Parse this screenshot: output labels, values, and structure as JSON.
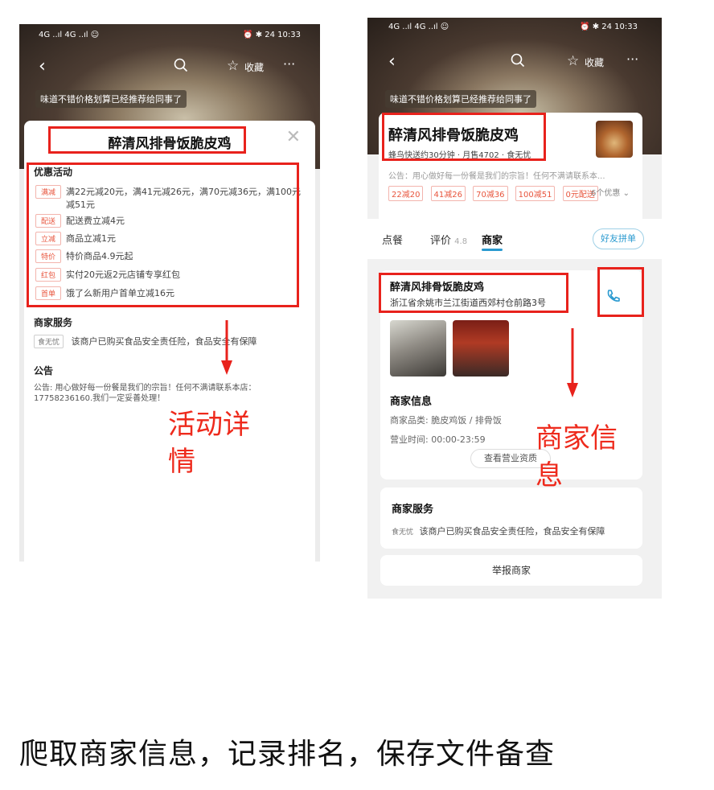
{
  "left_phone": {
    "status_left": "4G ..ıl 4G ..ıl ☺",
    "status_right": "⏰ ✱ 24 10:33",
    "banner": "味道不错价格划算已经推荐给同事了",
    "shop_name": "醉清风排骨饭脆皮鸡",
    "promotions_heading": "优惠活动",
    "promotions": [
      {
        "tag": "满减",
        "text": "满22元减20元，满41元减26元，满70元减36元，满100元减51元"
      },
      {
        "tag": "配送",
        "text": "配送费立减4元"
      },
      {
        "tag": "立减",
        "text": "商品立减1元"
      },
      {
        "tag": "特价",
        "text": "特价商品4.9元起"
      },
      {
        "tag": "红包",
        "text": "实付20元返2元店铺专享红包"
      },
      {
        "tag": "首单",
        "text": "饿了么新用户首单立减16元"
      }
    ],
    "service_heading": "商家服务",
    "service_tag": "食无忧",
    "service_text": "该商户已购买食品安全责任险，食品安全有保障",
    "notice_heading": "公告",
    "notice_text": "公告: 用心做好每一份餐是我们的宗旨！任何不满请联系本店：17758236160.我们一定妥善处理！",
    "fav_label": "收藏"
  },
  "annotation_left": "活动详情",
  "annotation_right": "商家信息",
  "right_phone": {
    "status_left": "4G ..ıl 4G ..ıl ☺",
    "status_right": "⏰ ✱ 24 10:33",
    "banner": "味道不错价格划算已经推荐给同事了",
    "fav_label": "收藏",
    "shop_name": "醉清风排骨饭脆皮鸡",
    "delivery_info": "蜂鸟快送约30分钟 · 月售4702 · 食无忧",
    "notice_short": "公告：用心做好每一份餐是我们的宗旨！任何不满请联系本...",
    "coupons": [
      "22减20",
      "41减26",
      "70减36",
      "100减51",
      "0元配送"
    ],
    "more_offers": "6个优惠",
    "tabs": [
      {
        "label": "点餐"
      },
      {
        "label": "评价",
        "badge": "4.8"
      },
      {
        "label": "商家"
      }
    ],
    "group_button": "好友拼单",
    "merchant_name": "醉清风排骨饭脆皮鸡",
    "merchant_address": "浙江省余姚市兰江街道西郊村仓前路3号",
    "info_heading": "商家信息",
    "category": "商家品类: 脆皮鸡饭 / 排骨饭",
    "hours": "营业时间: 00:00-23:59",
    "license_button": "查看营业资质",
    "service_heading": "商家服务",
    "service_tag": "食无忧",
    "service_text": "该商户已购买食品安全责任险，食品安全有保障",
    "report_button": "举报商家"
  },
  "caption": "爬取商家信息，记录排名，保存文件备查",
  "colors": {
    "annotation_red": "#ee2a1c",
    "box_red": "#e8221c",
    "promo_orange": "#e8553d",
    "link_blue": "#2a9ad0"
  }
}
